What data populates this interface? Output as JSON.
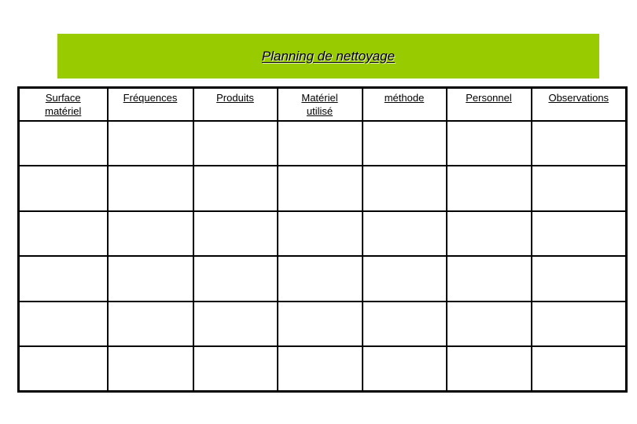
{
  "document": {
    "title": "Planning de nettoyage",
    "banner_color": "#99cc00"
  },
  "table": {
    "columns": [
      {
        "label": "Surface\nmatériel",
        "lines": [
          "Surface",
          "matériel"
        ]
      },
      {
        "label": "Fréquences",
        "lines": [
          "Fréquences"
        ]
      },
      {
        "label": "Produits",
        "lines": [
          "Produits"
        ]
      },
      {
        "label": "Matériel\nutilisé",
        "lines": [
          "Matériel",
          "utilisé"
        ]
      },
      {
        "label": "méthode",
        "lines": [
          "méthode"
        ]
      },
      {
        "label": "Personnel",
        "lines": [
          "Personnel"
        ]
      },
      {
        "label": "Observations",
        "lines": [
          "Observations"
        ]
      }
    ],
    "rows": [
      [
        "",
        "",
        "",
        "",
        "",
        "",
        ""
      ],
      [
        "",
        "",
        "",
        "",
        "",
        "",
        ""
      ],
      [
        "",
        "",
        "",
        "",
        "",
        "",
        ""
      ],
      [
        "",
        "",
        "",
        "",
        "",
        "",
        ""
      ],
      [
        "",
        "",
        "",
        "",
        "",
        "",
        ""
      ],
      [
        "",
        "",
        "",
        "",
        "",
        "",
        ""
      ]
    ]
  }
}
